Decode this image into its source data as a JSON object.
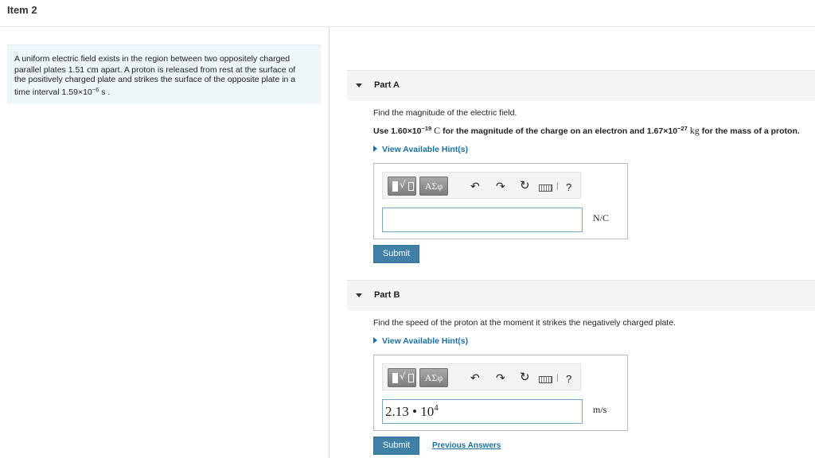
{
  "header": {
    "title": "Item 2"
  },
  "problem": {
    "line1": "A uniform electric field exists in the region between two oppositely charged",
    "line2a": "parallel plates 1.51 ",
    "line2_unit": "cm",
    "line2b": " apart. A proton is released from rest at the surface of",
    "line3": "the positively charged plate and strikes the surface of the opposite plate in a",
    "line4a": "time interval 1.59×10",
    "line4_exp": "−6",
    "line4b": " s ."
  },
  "partA": {
    "label": "Part A",
    "question": "Find the magnitude of the electric field.",
    "note": {
      "p1": "Use 1.60×10",
      "e1": "−19",
      "u1": " C",
      "p2": " for the magnitude of the charge on an electron and 1.67×10",
      "e2": "−27",
      "u2": " kg",
      "p3": " for the mass of a proton."
    },
    "hint": "View Available Hint(s)",
    "unit": "N/C",
    "answer": "",
    "submit": "Submit"
  },
  "partB": {
    "label": "Part B",
    "question": "Find the speed of the proton at the moment it strikes the negatively charged plate.",
    "hint": "View Available Hint(s)",
    "answer_mantissa": "2.13 • 10",
    "answer_exp": "4",
    "unit": "m/s",
    "submit": "Submit",
    "previous": "Previous Answers"
  },
  "toolbar": {
    "greek": "ΑΣφ",
    "undo": "↶",
    "redo": "↷",
    "reset": "↻",
    "help": "?",
    "icons": [
      "templates-icon",
      "greek-symbols-icon",
      "undo-icon",
      "redo-icon",
      "reset-icon",
      "keyboard-icon",
      "help-icon"
    ]
  }
}
